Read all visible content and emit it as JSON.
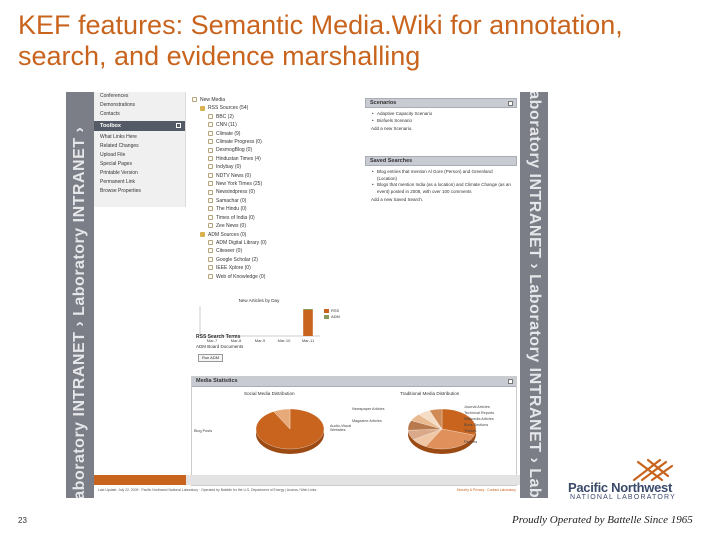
{
  "slide": {
    "title": "KEF features:  Semantic Media.Wiki for annotation, search, and evidence marshalling",
    "page_number": "23",
    "accent_color": "#c8641e"
  },
  "watermark": {
    "left_text": "Laboratory INTRANET  ›  Laboratory INTRANET  ›  ",
    "right_text": "Laboratory INTRANET  ›  Laboratory INTRANET  ›  Labora"
  },
  "nav": {
    "items_top": [
      "Conferences",
      "Demonstrations",
      "Contacts"
    ],
    "toolbox_label": "Toolbox",
    "items": [
      "What Links Here",
      "Related Changes",
      "Upload File",
      "Special Pages",
      "Printable Version",
      "Permanent Link",
      "Browse Properties"
    ]
  },
  "feed": {
    "rows": [
      {
        "label": "New Media",
        "indent": 0,
        "icon": "page"
      },
      {
        "label": "RSS Sources (54)",
        "indent": 1,
        "icon": "folder"
      },
      {
        "label": "BBC (2)",
        "indent": 2,
        "icon": "page"
      },
      {
        "label": "CNN (11)",
        "indent": 2,
        "icon": "page"
      },
      {
        "label": "Climate (9)",
        "indent": 2,
        "icon": "page"
      },
      {
        "label": "Climate Progress (0)",
        "indent": 2,
        "icon": "page"
      },
      {
        "label": "DesmogBlog (0)",
        "indent": 2,
        "icon": "page"
      },
      {
        "label": "Hindustan Times (4)",
        "indent": 2,
        "icon": "page"
      },
      {
        "label": "Indybay (0)",
        "indent": 2,
        "icon": "page"
      },
      {
        "label": "NDTV News (0)",
        "indent": 2,
        "icon": "page"
      },
      {
        "label": "New York Times (25)",
        "indent": 2,
        "icon": "page"
      },
      {
        "label": "Newsindpress (0)",
        "indent": 2,
        "icon": "page"
      },
      {
        "label": "Samachar (0)",
        "indent": 2,
        "icon": "page"
      },
      {
        "label": "The Hindu (0)",
        "indent": 2,
        "icon": "page"
      },
      {
        "label": "Times of India (0)",
        "indent": 2,
        "icon": "page"
      },
      {
        "label": "Zee News (0)",
        "indent": 2,
        "icon": "page"
      },
      {
        "label": "ADM Sources (0)",
        "indent": 1,
        "icon": "folder"
      },
      {
        "label": "ADM Digital Library (0)",
        "indent": 2,
        "icon": "page"
      },
      {
        "label": "Citeseer (0)",
        "indent": 2,
        "icon": "page"
      },
      {
        "label": "Google Scholar (2)",
        "indent": 2,
        "icon": "page"
      },
      {
        "label": "IEEE Xplore (0)",
        "indent": 2,
        "icon": "page"
      },
      {
        "label": "Web of Knowledge (0)",
        "indent": 2,
        "icon": "page"
      }
    ]
  },
  "chart_data": [
    {
      "type": "bar",
      "title": "New Articles by Day",
      "categories": [
        "Mar-7",
        "Mar-8",
        "Mar-9",
        "Mar-10",
        "Mar-11"
      ],
      "series": [
        {
          "name": "RSS",
          "values": [
            0,
            0,
            0,
            0,
            52
          ],
          "color": "#c8641e"
        },
        {
          "name": "ADM",
          "values": [
            0,
            0,
            0,
            0,
            2
          ],
          "color": "#8a9a5b"
        }
      ],
      "ylim": [
        0,
        60
      ],
      "grid": false,
      "legend": "right"
    },
    {
      "type": "pie",
      "title": "Social Media Distribution",
      "labels": [
        "Blog Posts",
        "Audio-Visual Websites"
      ],
      "values": [
        92,
        8
      ],
      "colors": [
        "#c8641e",
        "#e8a978"
      ]
    },
    {
      "type": "pie",
      "title": "Traditional Media Distribution",
      "labels": [
        "Newspaper Articles",
        "Magazine Articles",
        "Journal Articles",
        "Technical Reports",
        "Wikipedia Articles",
        "Book Sections",
        "Theses",
        "Reports"
      ],
      "values": [
        30,
        28,
        8,
        8,
        8,
        6,
        6,
        6
      ],
      "colors": [
        "#c8641e",
        "#e0905a",
        "#f0c7a5",
        "#d9a98a",
        "#b8794d",
        "#e9b98f",
        "#f5dcc6",
        "#cf8a55"
      ]
    }
  ],
  "rss": {
    "heading": "RSS Search Terms",
    "terms": "ADM Board Documents",
    "button": "Run ADM"
  },
  "scenarios": {
    "heading": "Scenarios",
    "items": [
      "Adaptive Capacity Scenario",
      "Biofuels Scenario"
    ],
    "add": "Add a new Scenario."
  },
  "saved_searches": {
    "heading": "Saved Searches",
    "items": [
      "Blog entries that mention Al Gore (Person) and Greenland (Location)",
      "Blogs that mention India (as a location) and Climate Change (as an event) posted in 2008, with over 100 comments"
    ],
    "add": "Add a new Saved Search."
  },
  "media": {
    "heading": "Media Statistics",
    "social_title": "Social Media Distribution",
    "traditional_title": "Traditional Media Distribution"
  },
  "footer": {
    "left": "Last Update: July 22, 2009 · Pacific Northwest National Laboratory · Operated by Battelle for the U.S. Department of Energy | Access / Web Links",
    "right": "Security & Privacy · Contact Laboratory"
  },
  "branding": {
    "org": "Pacific Northwest",
    "org_sub": "NATIONAL LABORATORY",
    "operated": "Proudly Operated by Battelle Since 1965"
  }
}
